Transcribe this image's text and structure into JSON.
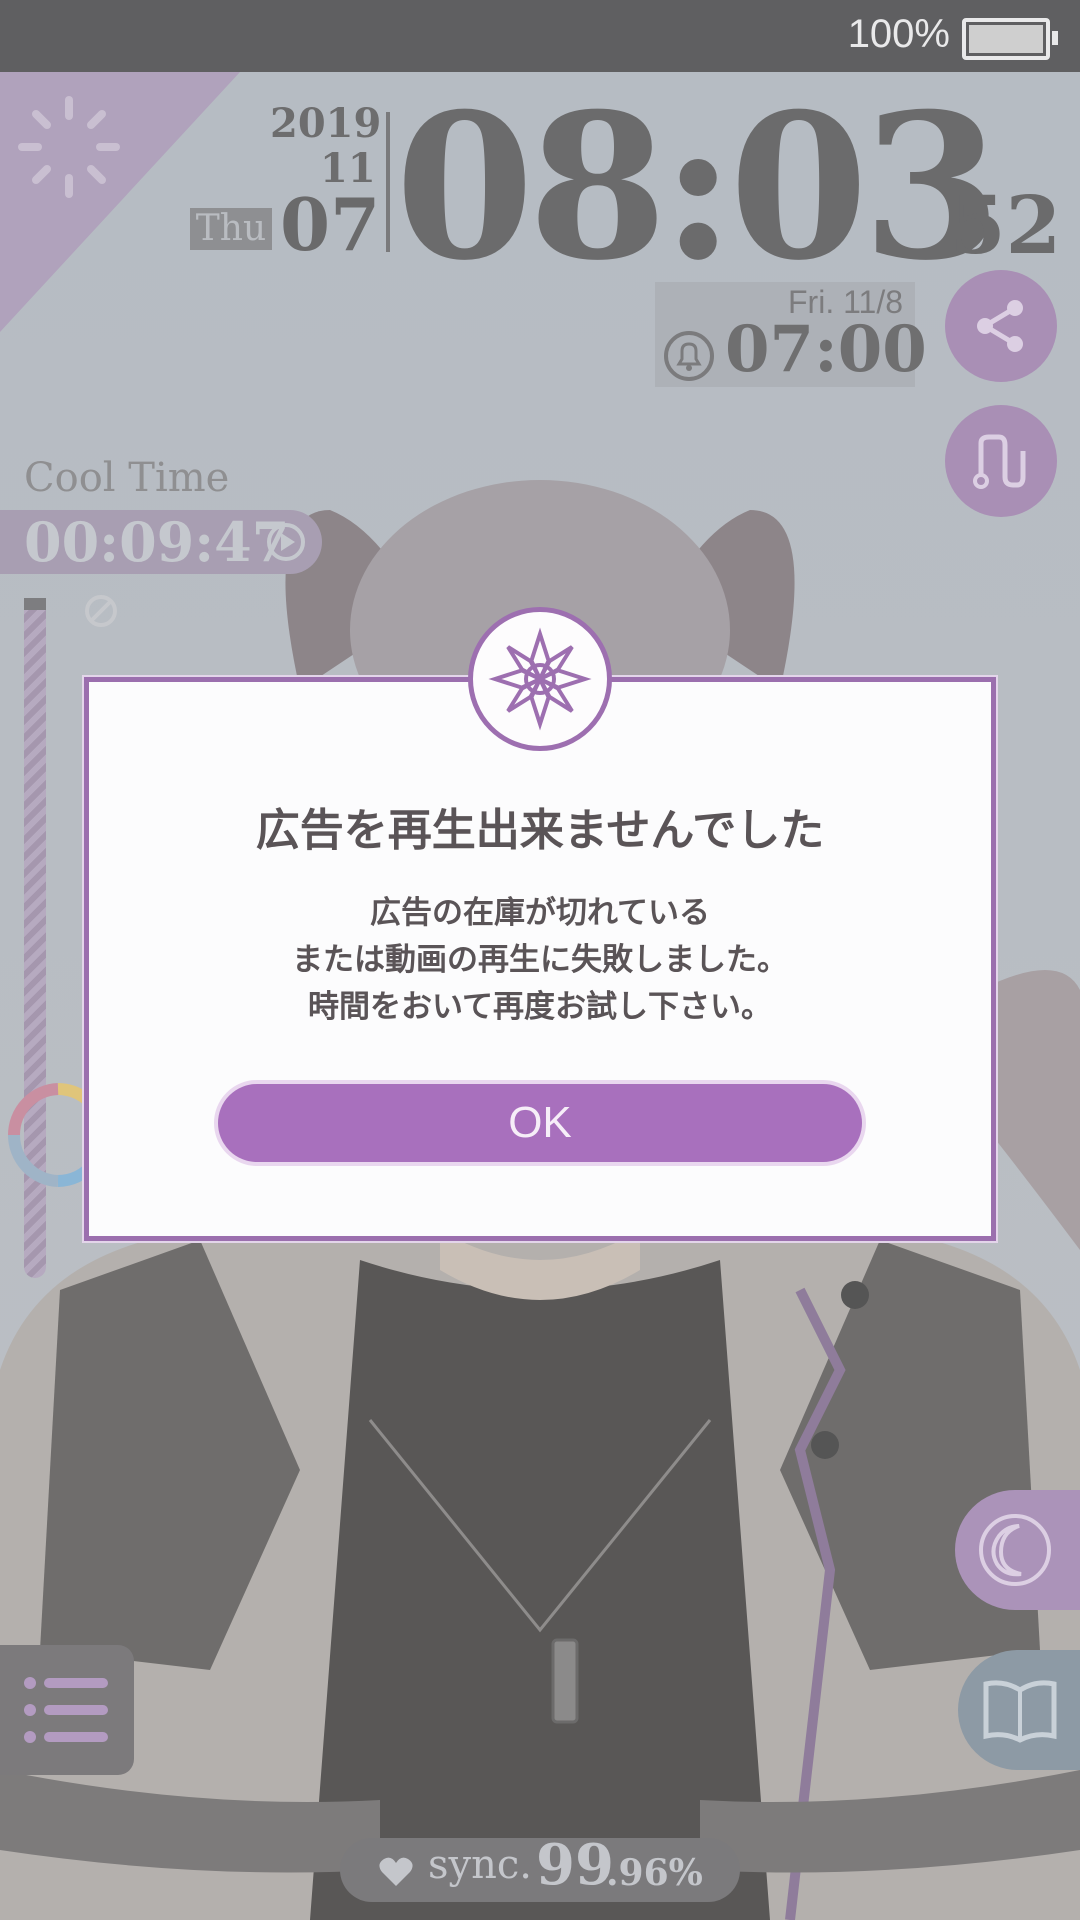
{
  "status_bar": {
    "battery_percent": "100%"
  },
  "clock": {
    "year": "2019",
    "month": "11",
    "weekday": "Thu",
    "day": "07",
    "time": "08:03",
    "seconds": "52"
  },
  "alarm": {
    "date": "Fri.  11/8",
    "time": "07:00"
  },
  "cool_time": {
    "label": "Cool Time",
    "value": "00:09:47"
  },
  "sync": {
    "label": "sync.",
    "value_int": "99",
    "value_dec": ".96%"
  },
  "dialog": {
    "title": "広告を再生出来ませんでした",
    "message_lines": [
      "広告の在庫が切れている",
      "または動画の再生に失敗しました。",
      "時間をおいて再度お試し下さい。"
    ],
    "ok_label": "OK"
  },
  "colors": {
    "accent": "#a870bd",
    "dialog_border": "#9b6fae",
    "status_bar": "#5f5f61"
  },
  "icons": {
    "share": "share-icon",
    "route": "route-icon",
    "moon": "moon-icon",
    "book": "book-icon",
    "menu": "menu-list-icon",
    "bell": "bell-icon",
    "play": "play-icon",
    "heart": "heart-icon",
    "emblem": "flower-emblem-icon"
  }
}
